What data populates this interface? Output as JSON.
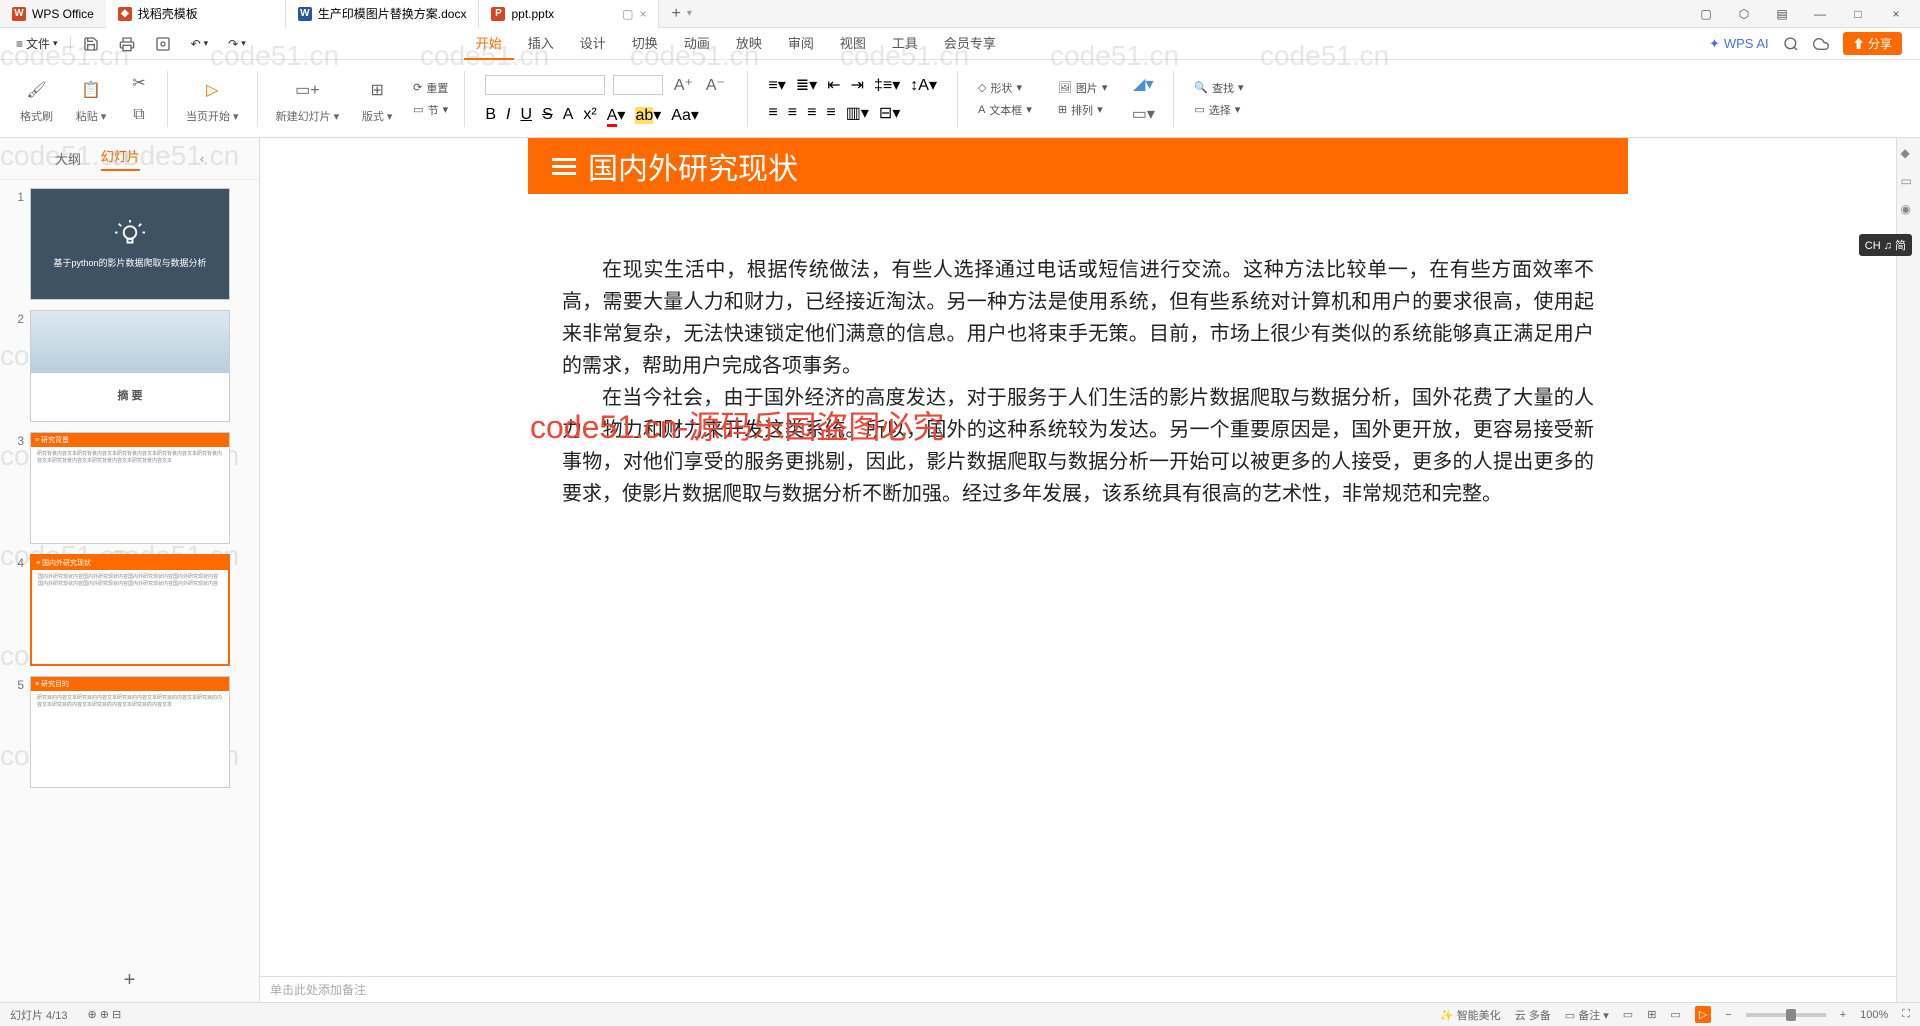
{
  "titlebar": {
    "app": "WPS Office",
    "tabs": [
      {
        "icon": "S",
        "label": "找稻壳模板"
      },
      {
        "icon": "W",
        "label": "生产印模图片替换方案.docx"
      },
      {
        "icon": "P",
        "label": "ppt.pptx"
      }
    ]
  },
  "menubar": {
    "file": "文件",
    "ribbonTabs": [
      "开始",
      "插入",
      "设计",
      "切换",
      "动画",
      "放映",
      "审阅",
      "视图",
      "工具",
      "会员专享"
    ],
    "ai": "WPS AI",
    "share": "分享"
  },
  "ribbon": {
    "formatBrush": "格式刷",
    "paste": "粘贴",
    "startFromCurrent": "当页开始",
    "newSlide": "新建幻灯片",
    "layout": "版式",
    "reset": "重置",
    "section": "节",
    "shape": "形状",
    "picture": "图片",
    "textbox": "文本框",
    "arrange": "排列",
    "find": "查找",
    "select": "选择"
  },
  "leftpane": {
    "outline": "大纲",
    "slides": "幻灯片",
    "collapse": "‹",
    "thumb1_title": "基于python的影片数据爬取与数据分析",
    "thumb2_title": "摘   要",
    "thumb3_head": "≡ 研究背景",
    "thumb4_head": "≡ 国内外研究现状",
    "thumb5_head": "≡ 研究目的"
  },
  "slide": {
    "title": "国内外研究现状",
    "para1": "在现实生活中，根据传统做法，有些人选择通过电话或短信进行交流。这种方法比较单一，在有些方面效率不高，需要大量人力和财力，已经接近淘汰。另一种方法是使用系统，但有些系统对计算机和用户的要求很高，使用起来非常复杂，无法快速锁定他们满意的信息。用户也将束手无策。目前，市场上很少有类似的系统能够真正满足用户的需求，帮助用户完成各项事务。",
    "para2": "在当今社会，由于国外经济的高度发达，对于服务于人们生活的影片数据爬取与数据分析，国外花费了大量的人力、物力和财力来开发这类系统。所以，国外的这种系统较为发达。另一个重要原因是，国外更开放，更容易接受新事物，对他们享受的服务更挑剔，因此，影片数据爬取与数据分析一开始可以被更多的人接受，更多的人提出更多的要求，使影片数据爬取与数据分析不断加强。经过多年发展，该系统具有很高的艺术性，非常规范和完整。"
  },
  "wm": {
    "light": "code51.cn",
    "red": "code51.cn-源码乐园盗图必究"
  },
  "notes": {
    "placeholder": "单击此处添加备注"
  },
  "statusbar": {
    "slideInfo": "幻灯片 4/13",
    "smartBeautify": "智能美化",
    "template": "云 多备",
    "notes": "备注",
    "zoom": "100%"
  },
  "ime": "CH ♫ 简"
}
